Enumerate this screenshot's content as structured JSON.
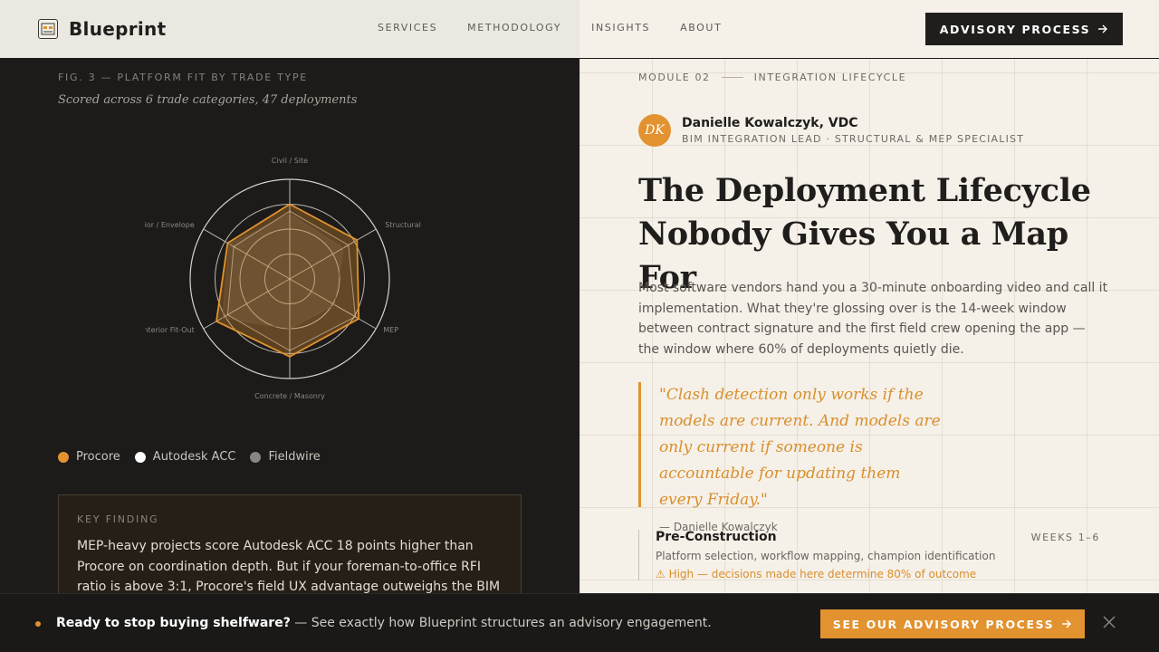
{
  "header": {
    "brand": "Blueprint",
    "nav": [
      "SERVICES",
      "METHODOLOGY",
      "INSIGHTS",
      "ABOUT"
    ],
    "cta_label": "ADVISORY PROCESS",
    "cta_icon": "arrow-right-icon"
  },
  "figure": {
    "label": "FIG. 3 — PLATFORM FIT BY TRADE TYPE",
    "subtitle": "Scored across 6 trade categories, 47 deployments"
  },
  "chart_data": {
    "type": "radar",
    "axes": [
      "Civil / Site",
      "Structural",
      "MEP",
      "Concrete / Masonry",
      "Interior Fit-Out",
      "Exterior / Envelope"
    ],
    "rlim": [
      0,
      100
    ],
    "rings": 4,
    "series": [
      {
        "name": "Procore",
        "color": "#e2922f",
        "values": [
          75,
          78,
          80,
          78,
          85,
          72
        ]
      },
      {
        "name": "Autodesk ACC",
        "color": "#ffffff",
        "values": [
          68,
          68,
          76,
          72,
          72,
          65
        ]
      },
      {
        "name": "Fieldwire",
        "color": "#8a8580",
        "values": [
          65,
          62,
          52,
          50,
          78,
          70
        ]
      }
    ],
    "legend": "bottom-left"
  },
  "finding": {
    "label": "KEY FINDING",
    "text": "MEP-heavy projects score Autodesk ACC 18 points higher than Procore on coordination depth. But if your foreman-to-office RFI ratio is above 3:1, Procore's field UX advantage outweighs the BIM"
  },
  "article": {
    "module_num": "MODULE 02",
    "module_title": "INTEGRATION LIFECYCLE",
    "author_initials": "DK",
    "author_name": "Danielle Kowalczyk, VDC",
    "author_role": "BIM INTEGRATION LEAD · STRUCTURAL & MEP SPECIALIST",
    "headline": "The Deployment Lifecycle Nobody Gives You a Map For",
    "lead": "Most software vendors hand you a 30-minute onboarding video and call it implementation. What they're glossing over is the 14-week window between contract signature and the first field crew opening the app — the window where 60% of deployments quietly die.",
    "quote": "\"Clash detection only works if the models are current. And models are only current if someone is accountable for updating them every Friday.\"",
    "quote_attr": "— Danielle Kowalczyk",
    "phase": {
      "title": "Pre-Construction",
      "weeks": "WEEKS 1–6",
      "desc": "Platform selection, workflow mapping, champion identification",
      "note": "⚠ High — decisions made here determine 80% of outcome"
    }
  },
  "banner": {
    "lead": "Ready to stop buying shelfware?",
    "text": " — See exactly how Blueprint structures an advisory engagement.",
    "cta_label": "SEE OUR ADVISORY PROCESS",
    "accent": "#e2922f"
  }
}
